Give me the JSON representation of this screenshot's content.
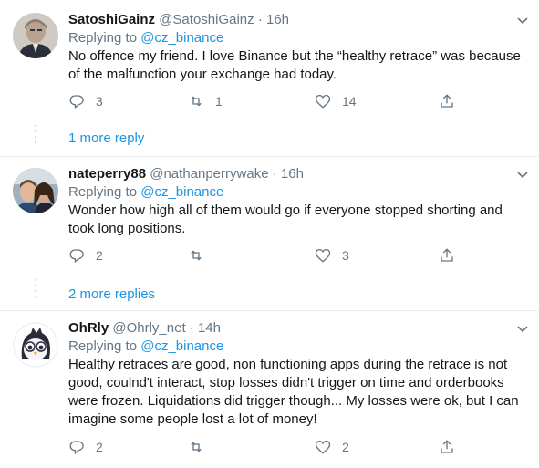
{
  "tweets": [
    {
      "name": "SatoshiGainz",
      "handle": "@SatoshiGainz",
      "time": "· 16h",
      "replying_label": "Replying to",
      "replying_to": "@cz_binance",
      "text": "No offence my friend. I love Binance but the “healthy retrace” was because of the malfunction your exchange had today.",
      "replies": "3",
      "retweets": "1",
      "likes": "14",
      "more_replies": "1 more reply"
    },
    {
      "name": "nateperry88",
      "handle": "@nathanperrywake",
      "time": "· 16h",
      "replying_label": "Replying to",
      "replying_to": "@cz_binance",
      "text": "Wonder how high all of them would go if everyone stopped shorting and took long positions.",
      "replies": "2",
      "retweets": "",
      "likes": "3",
      "more_replies": "2 more replies"
    },
    {
      "name": "OhRly",
      "handle": "@Ohrly_net",
      "time": "· 14h",
      "replying_label": "Replying to",
      "replying_to": "@cz_binance",
      "text": "Healthy retraces are good, non functioning apps during the retrace is not good, coulnd't interact, stop losses didn't trigger on time and orderbooks were frozen. Liquidations did trigger though... My losses were ok, but I can imagine some people lost a lot of money!",
      "replies": "2",
      "retweets": "",
      "likes": "2"
    }
  ],
  "colors": {
    "link": "#1b95e0",
    "muted": "#657786",
    "text": "#14171a",
    "divider": "#e6ecf0"
  },
  "icons": [
    "reply-icon",
    "retweet-icon",
    "like-icon",
    "share-icon",
    "chevron-down-icon"
  ]
}
